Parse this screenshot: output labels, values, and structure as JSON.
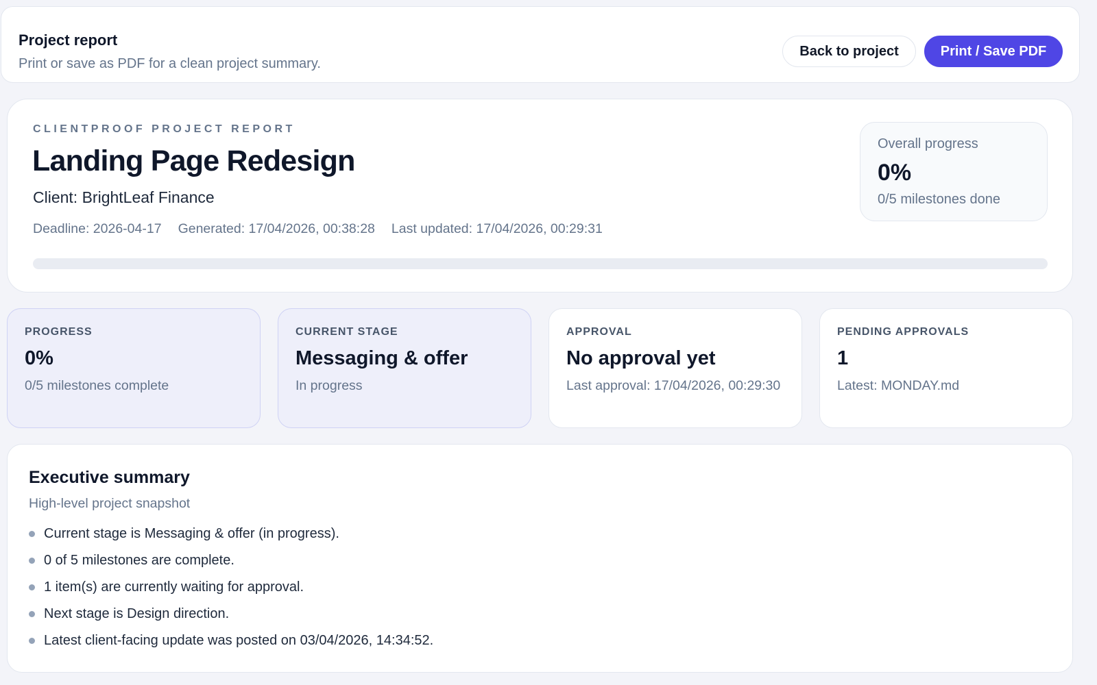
{
  "toolbar": {
    "title": "Project report",
    "subtitle": "Print or save as PDF for a clean project summary.",
    "back_label": "Back to project",
    "print_label": "Print / Save PDF"
  },
  "hero": {
    "eyebrow": "CLIENTPROOF PROJECT REPORT",
    "title": "Landing Page Redesign",
    "client": "Client: BrightLeaf Finance",
    "deadline": "Deadline: 2026-04-17",
    "generated": "Generated: 17/04/2026, 00:38:28",
    "last_updated": "Last updated: 17/04/2026, 00:29:31",
    "progress_fraction": 0
  },
  "overall": {
    "label": "Overall progress",
    "value": "0%",
    "sub": "0/5 milestones done"
  },
  "stats": [
    {
      "label": "PROGRESS",
      "value": "0%",
      "sub": "0/5 milestones complete"
    },
    {
      "label": "CURRENT STAGE",
      "value": "Messaging & offer",
      "sub": "In progress"
    },
    {
      "label": "APPROVAL",
      "value": "No approval yet",
      "sub": "Last approval: 17/04/2026, 00:29:30"
    },
    {
      "label": "PENDING APPROVALS",
      "value": "1",
      "sub": "Latest: MONDAY.md"
    }
  ],
  "summary": {
    "title": "Executive summary",
    "subtitle": "High-level project snapshot",
    "items": [
      "Current stage is Messaging & offer (in progress).",
      "0 of 5 milestones are complete.",
      "1 item(s) are currently waiting for approval.",
      "Next stage is Design direction.",
      "Latest client-facing update was posted on 03/04/2026, 14:34:52."
    ]
  },
  "colors": {
    "accent": "#4f46e5",
    "page_background": "#f3f4f9",
    "accent_card_background": "#eeeffa"
  }
}
